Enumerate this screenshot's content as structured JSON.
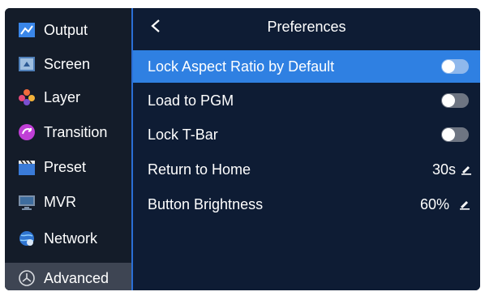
{
  "sidebar": {
    "items": [
      {
        "label": "Output",
        "icon": "output-icon"
      },
      {
        "label": "Screen",
        "icon": "screen-icon"
      },
      {
        "label": "Layer",
        "icon": "layer-icon"
      },
      {
        "label": "Transition",
        "icon": "transition-icon"
      },
      {
        "label": "Preset",
        "icon": "preset-icon"
      },
      {
        "label": "MVR",
        "icon": "mvr-icon"
      },
      {
        "label": "Network",
        "icon": "network-icon"
      },
      {
        "label": "Advanced",
        "icon": "advanced-icon"
      }
    ],
    "active": "Advanced"
  },
  "header": {
    "title": "Preferences",
    "back_icon": "chevron-left-icon"
  },
  "settings": {
    "lock_aspect": {
      "label": "Lock Aspect Ratio by Default",
      "state": "off"
    },
    "load_pgm": {
      "label": "Load to PGM",
      "state": "off"
    },
    "lock_tbar": {
      "label": "Lock T-Bar",
      "state": "off"
    },
    "return_home": {
      "label": "Return to Home",
      "value": "30s",
      "icon": "edit-icon"
    },
    "button_brightness": {
      "label": "Button Brightness",
      "value": "60%",
      "icon": "edit-icon"
    }
  },
  "colors": {
    "accent": "#2f80e2",
    "sidebar_bg": "#141c29",
    "panel_bg": "#0e1c34",
    "active_item": "#3e4553",
    "toggle_off": "#6e7582"
  }
}
